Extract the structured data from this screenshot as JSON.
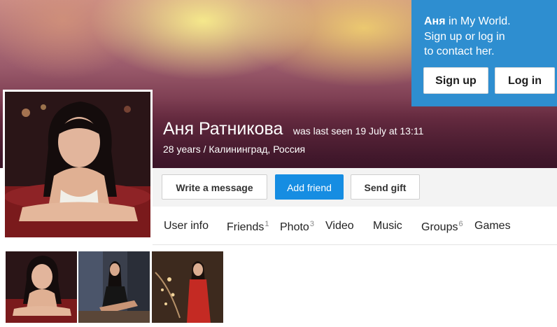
{
  "profile": {
    "name": "Аня Ратникова",
    "last_seen": "was last seen 19 July at 13:11",
    "details": "28 years / Калининград, Россия"
  },
  "promo": {
    "name_bold": "Аня",
    "line1_rest": " in My World.",
    "line2": "Sign up or log in",
    "line3": "to contact her.",
    "signup_label": "Sign up",
    "login_label": "Log in",
    "color": "#2e8ed0"
  },
  "actions": {
    "write_message": "Write a message",
    "add_friend": "Add friend",
    "send_gift": "Send gift",
    "accent": "#168de2"
  },
  "tabs": [
    {
      "label": "User info",
      "count": ""
    },
    {
      "label": "Friends",
      "count": "1"
    },
    {
      "label": "Photo",
      "count": "3"
    },
    {
      "label": "Video",
      "count": ""
    },
    {
      "label": "Music",
      "count": ""
    },
    {
      "label": "Groups",
      "count": "6"
    },
    {
      "label": "Games",
      "count": ""
    }
  ]
}
